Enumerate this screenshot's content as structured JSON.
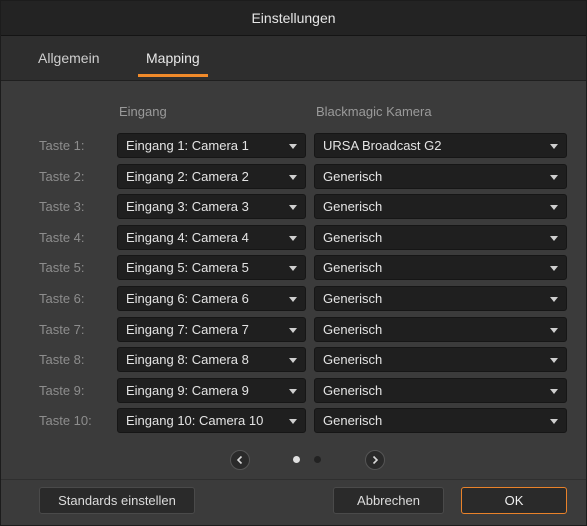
{
  "window": {
    "title": "Einstellungen"
  },
  "tabs": [
    {
      "label": "Allgemein",
      "active": false
    },
    {
      "label": "Mapping",
      "active": true
    }
  ],
  "columns": {
    "input": "Eingang",
    "camera": "Blackmagic Kamera"
  },
  "rows": [
    {
      "label": "Taste 1:",
      "input": "Eingang 1: Camera 1",
      "camera": "URSA Broadcast G2"
    },
    {
      "label": "Taste 2:",
      "input": "Eingang 2: Camera 2",
      "camera": "Generisch"
    },
    {
      "label": "Taste 3:",
      "input": "Eingang 3: Camera 3",
      "camera": "Generisch"
    },
    {
      "label": "Taste 4:",
      "input": "Eingang 4: Camera 4",
      "camera": "Generisch"
    },
    {
      "label": "Taste 5:",
      "input": "Eingang 5: Camera 5",
      "camera": "Generisch"
    },
    {
      "label": "Taste 6:",
      "input": "Eingang 6: Camera 6",
      "camera": "Generisch"
    },
    {
      "label": "Taste 7:",
      "input": "Eingang 7: Camera 7",
      "camera": "Generisch"
    },
    {
      "label": "Taste 8:",
      "input": "Eingang 8: Camera 8",
      "camera": "Generisch"
    },
    {
      "label": "Taste 9:",
      "input": "Eingang 9: Camera 9",
      "camera": "Generisch"
    },
    {
      "label": "Taste 10:",
      "input": "Eingang 10: Camera 10",
      "camera": "Generisch"
    }
  ],
  "pager": {
    "current_page": 1,
    "total_pages": 2
  },
  "buttons": {
    "defaults": "Standards einstellen",
    "cancel": "Abbrechen",
    "ok": "OK"
  },
  "colors": {
    "accent": "#f08a2a",
    "background": "#3b3b3b",
    "dropdown": "#1f1f1f"
  }
}
